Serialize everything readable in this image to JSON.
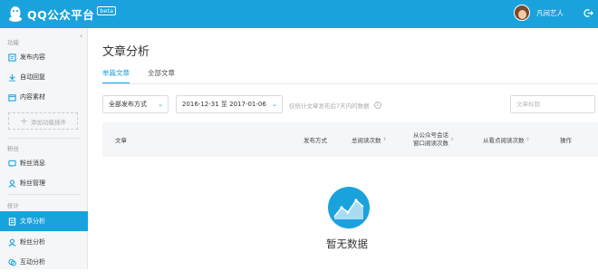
{
  "header": {
    "app_title": "QQ公众平台",
    "beta_badge": "beta",
    "user_name": "凡间艺人"
  },
  "sidebar": {
    "sections": [
      {
        "label": "功能",
        "items": [
          {
            "label": "发布内容"
          },
          {
            "label": "自动回复"
          },
          {
            "label": "内容素材"
          }
        ],
        "add_button": "添加功能插件"
      },
      {
        "label": "粉丝",
        "items": [
          {
            "label": "粉丝消息"
          },
          {
            "label": "粉丝管理"
          }
        ]
      },
      {
        "label": "统计",
        "items": [
          {
            "label": "文章分析",
            "active": true
          },
          {
            "label": "粉丝分析"
          },
          {
            "label": "互动分析"
          }
        ]
      }
    ]
  },
  "main": {
    "title": "文章分析",
    "tabs": [
      {
        "label": "单篇文章",
        "active": true
      },
      {
        "label": "全部文章"
      }
    ],
    "filters": {
      "publish_type": "全部发布方式",
      "date_range": "2016-12-31 至 2017-01-06",
      "hint": "仅统计文章发布后7天内的数据",
      "search_placeholder": "文章标题"
    },
    "table": {
      "columns": [
        {
          "label": "文章"
        },
        {
          "label": "发布方式"
        },
        {
          "label": "总阅读次数",
          "sortable": true
        },
        {
          "label_line1": "从公众号会话",
          "label_line2": "窗口阅读次数",
          "sortable": true
        },
        {
          "label": "从看点阅读次数",
          "sortable": true
        },
        {
          "label": "操作"
        }
      ]
    },
    "empty_state": {
      "text": "暂无数据"
    }
  },
  "colors": {
    "accent": "#1AA2DD",
    "sidebar_bg": "#F4F6F8"
  }
}
